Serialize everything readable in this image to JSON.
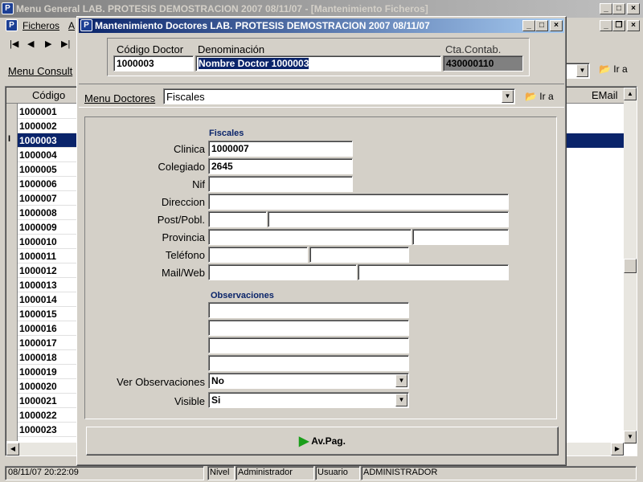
{
  "main_window": {
    "icon_letter": "P",
    "title": "Menu General   LAB. PROTESIS DEMOSTRACION   2007   08/11/07 - [Mantenimiento Ficheros]",
    "menu": [
      "Ficheros",
      "A"
    ],
    "consult_label": "Menu Consult",
    "ira_label": "Ir a",
    "grid_header_codigo": "Código",
    "grid_header_email": "EMail",
    "rows": [
      "1000001",
      "1000002",
      "1000003",
      "1000004",
      "1000005",
      "1000006",
      "1000007",
      "1000008",
      "1000009",
      "1000010",
      "1000011",
      "1000012",
      "1000013",
      "1000014",
      "1000015",
      "1000016",
      "1000017",
      "1000018",
      "1000019",
      "1000020",
      "1000021",
      "1000022",
      "1000023"
    ],
    "selected_row": "1000003",
    "status": {
      "datetime": "08/11/07 20:22:09",
      "nivel_label": "Nivel",
      "nivel_value": "Administrador",
      "usuario_label": "Usuario",
      "usuario_value": "ADMINISTRADOR"
    }
  },
  "dialog": {
    "icon_letter": "P",
    "title": "Mantenimiento Doctores   LAB. PROTESIS DEMOSTRACION   2007   08/11/07",
    "codigo_label": "Código Doctor",
    "codigo_value": "1000003",
    "denominacion_label": "Denominación",
    "denominacion_value": "Nombre Doctor 1000003",
    "cta_label": "Cta.Contab.",
    "cta_value": "430000110",
    "menu_label": "Menu Doctores",
    "menu_value": "Fiscales",
    "ira_label": "Ir a",
    "fiscales_header": "Fiscales",
    "fields": {
      "clinica_label": "Clinica",
      "clinica_value": "1000007",
      "colegiado_label": "Colegiado",
      "colegiado_value": "2645",
      "nif_label": "Nif",
      "direccion_label": "Direccion",
      "postpobl_label": "Post/Pobl.",
      "provincia_label": "Provincia",
      "telefono_label": "Teléfono",
      "mailweb_label": "Mail/Web"
    },
    "observaciones_header": "Observaciones",
    "ver_obs_label": "Ver Observaciones",
    "ver_obs_value": "No",
    "visible_label": "Visible",
    "visible_value": "Si",
    "avpag_label": "Av.Pag."
  }
}
